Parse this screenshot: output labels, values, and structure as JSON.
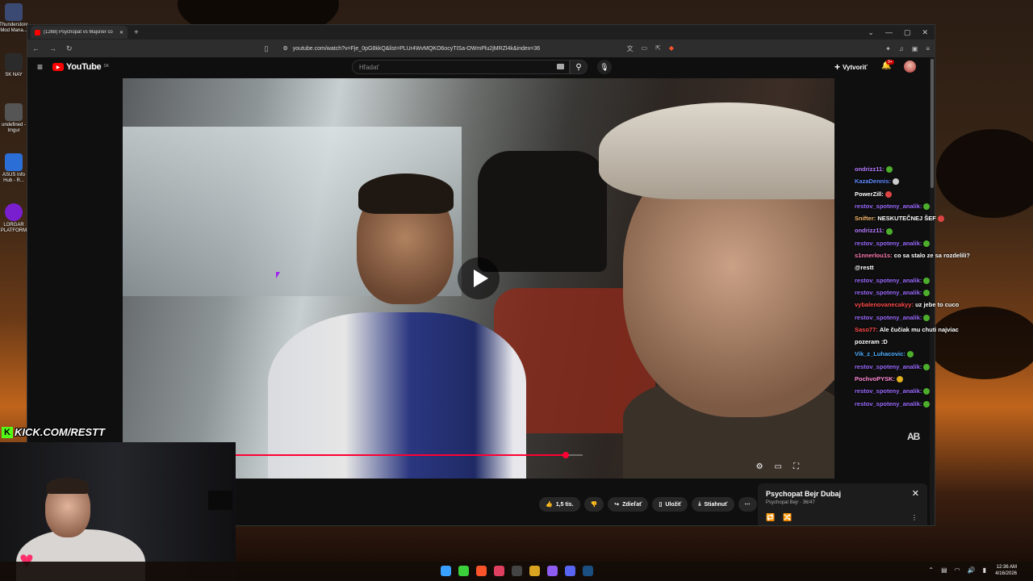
{
  "desktop": {
    "icons": [
      {
        "label": "Thunderstore Mod Mana...",
        "color": "#3b4a73"
      },
      {
        "label": "SK NAY",
        "color": "#2b2b2b"
      },
      {
        "label": "undefined - Imgur",
        "color": "#555555"
      },
      {
        "label": "ASUS Info Hub - R...",
        "color": "#2b6fd6"
      },
      {
        "label": "LORGAR PLATFORM",
        "color": "#7a1fd0"
      }
    ]
  },
  "browser": {
    "tab_title": "(1268) Psychopat vs Majsner co",
    "new_tab": "+",
    "url": "youtube.com/watch?v=Fje_0pG8kkQ&list=PLUr4WvMQKO6ocyTISa-OWmPlu2jMRZl4k&index=36"
  },
  "youtube": {
    "logo_text": "YouTube",
    "logo_country": "SK",
    "search_placeholder": "Hľadať",
    "create_label": "Vytvoriť",
    "notif_badge": "9+"
  },
  "video": {
    "progress": 0.95
  },
  "chat": [
    {
      "user": "ondrizz11:",
      "color": "#b77cff",
      "msg": "",
      "emote": "#4cae2c"
    },
    {
      "user": "KazaDennis:",
      "color": "#5f8bff",
      "msg": "",
      "emote": "#cccccc"
    },
    {
      "user": "PowerZill:",
      "color": "#ffffff",
      "msg": "",
      "emote": "#d44"
    },
    {
      "user": "restov_spoteny_analik:",
      "color": "#9c6bff",
      "msg": "",
      "emote": "#4cae2c"
    },
    {
      "user": "Snifter:",
      "color": "#f5b86a",
      "msg": "NESKUTEČNEJ ŠEF",
      "emote": "#d44"
    },
    {
      "user": "ondrizz11:",
      "color": "#b77cff",
      "msg": "",
      "emote": "#4cae2c"
    },
    {
      "user": "restov_spoteny_analik:",
      "color": "#9c6bff",
      "msg": "",
      "emote": "#4cae2c"
    },
    {
      "user": "s1nnerlou1s:",
      "color": "#ff7ab0",
      "msg": "co sa stalo ze sa rozdelili?",
      "emote": ""
    },
    {
      "user": "",
      "color": "#ffffff",
      "msg": "@restt",
      "emote": ""
    },
    {
      "user": "restov_spoteny_analik:",
      "color": "#9c6bff",
      "msg": "",
      "emote": "#4cae2c"
    },
    {
      "user": "restov_spoteny_analik:",
      "color": "#9c6bff",
      "msg": "",
      "emote": "#4cae2c"
    },
    {
      "user": "vybalenovanecakyy:",
      "color": "#ff4a4a",
      "msg": "uz jebe to cuco",
      "emote": ""
    },
    {
      "user": "restov_spoteny_analik:",
      "color": "#9c6bff",
      "msg": "",
      "emote": "#4cae2c"
    },
    {
      "user": "Saso77:",
      "color": "#ff4a4a",
      "msg": "Ale čučiak mu chuti najviac",
      "emote": ""
    },
    {
      "user": "",
      "color": "#ffffff",
      "msg": "pozeram :D",
      "emote": ""
    },
    {
      "user": "Vik_z_Luhacovic:",
      "color": "#4fb0ff",
      "msg": "",
      "emote": "#4cae2c"
    },
    {
      "user": "restov_spoteny_analik:",
      "color": "#9c6bff",
      "msg": "",
      "emote": "#4cae2c"
    },
    {
      "user": "PochvoPYSK:",
      "color": "#ff8ad6",
      "msg": "",
      "emote": "#e0b020"
    },
    {
      "user": "restov_spoteny_analik:",
      "color": "#9c6bff",
      "msg": "",
      "emote": "#4cae2c"
    },
    {
      "user": "restov_spoteny_analik:",
      "color": "#9c6bff",
      "msg": "",
      "emote": "#4cae2c"
    }
  ],
  "actions": {
    "like": "1,5 tis.",
    "share": "Zdieľať",
    "save": "Uložiť",
    "download": "Stiahnuť"
  },
  "miniplayer": {
    "title": "Psychopat Bejr  Dubaj",
    "channel": "Psychopat Bejr",
    "position": "36/47"
  },
  "stream": {
    "kick": "KICK.COM/RESTT"
  },
  "taskbar": {
    "time": "12:36 AM",
    "date": "4/16/2026",
    "icons": [
      {
        "name": "windows-start-icon",
        "color": "#3aa0ff"
      },
      {
        "name": "app-green-icon",
        "color": "#3bd13b"
      },
      {
        "name": "brave-icon",
        "color": "#fb542b"
      },
      {
        "name": "maps-pin-icon",
        "color": "#e04060"
      },
      {
        "name": "terminal-icon",
        "color": "#444444"
      },
      {
        "name": "chrome-icon",
        "color": "#d9a520"
      },
      {
        "name": "music-icon",
        "color": "#8e5cf0"
      },
      {
        "name": "discord-icon",
        "color": "#5865f2"
      },
      {
        "name": "steam-icon",
        "color": "#1b4f82"
      }
    ]
  }
}
